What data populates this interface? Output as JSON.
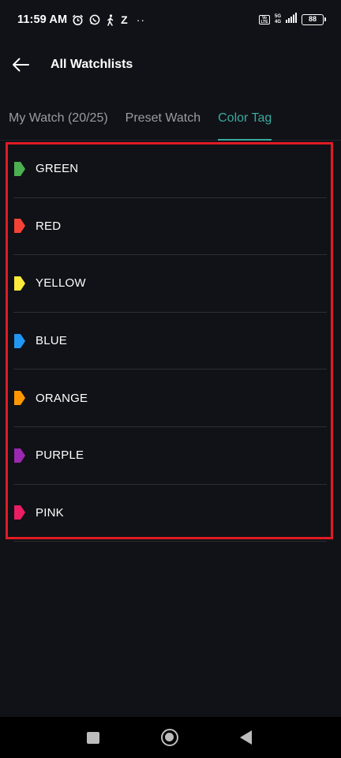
{
  "status_bar": {
    "time": "11:59 AM",
    "battery": "88",
    "network_top": "5G",
    "network_bottom": "4G",
    "volte": "Vo LTE",
    "notif_z": "Z",
    "dots": "··"
  },
  "header": {
    "title": "All Watchlists",
    "back_icon": "arrow-left-icon"
  },
  "tabs": [
    {
      "label": "My Watch (20/25)",
      "active": false
    },
    {
      "label": "Preset Watch",
      "active": false
    },
    {
      "label": "Color Tag",
      "active": true
    }
  ],
  "colors": {
    "accent": "#3aa99f",
    "highlight": "#e01b24",
    "background": "#111217"
  },
  "color_tags": [
    {
      "label": "GREEN",
      "color": "#4caf50"
    },
    {
      "label": "RED",
      "color": "#f44336"
    },
    {
      "label": "YELLOW",
      "color": "#ffeb3b"
    },
    {
      "label": "BLUE",
      "color": "#2196f3"
    },
    {
      "label": "ORANGE",
      "color": "#ff9800"
    },
    {
      "label": "PURPLE",
      "color": "#9c27b0"
    },
    {
      "label": "PINK",
      "color": "#e91e63"
    }
  ]
}
